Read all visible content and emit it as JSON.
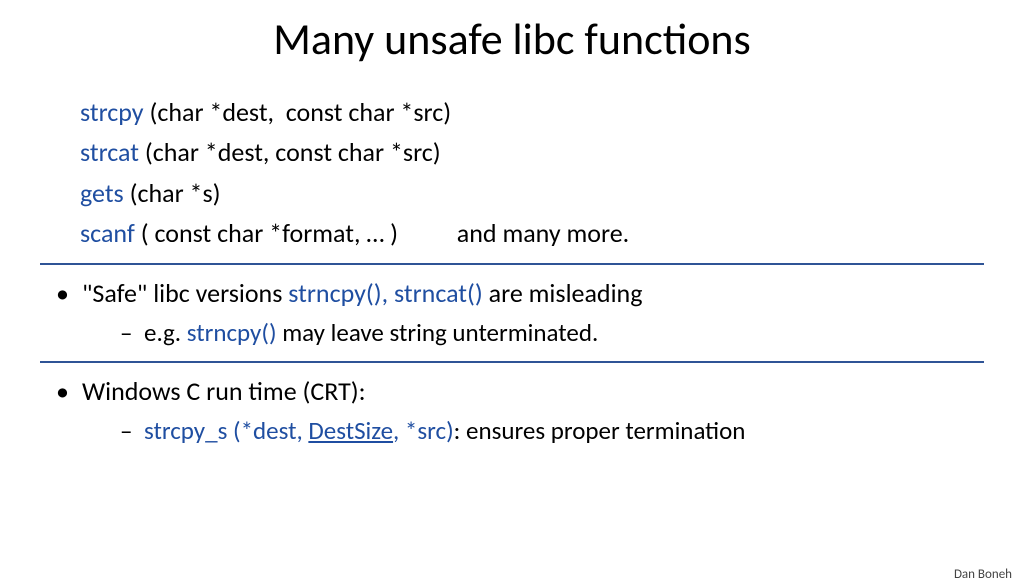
{
  "title": "Many unsafe libc functions",
  "functions": {
    "strcpy": {
      "name": "strcpy",
      "sig": " (char *dest,  const char *src)"
    },
    "strcat": {
      "name": "strcat",
      "sig": " (char *dest, const char *src)"
    },
    "gets": {
      "name": "gets",
      "sig": " (char *s)"
    },
    "scanf": {
      "name": "scanf",
      "sig": " ( const char *format, … )",
      "trail": "          and many more."
    }
  },
  "safe": {
    "lead": "\"Safe\" libc versions  ",
    "fns": "strncpy(), strncat()",
    "trail": "  are misleading",
    "sub_lead": "e.g.  ",
    "sub_fn": "strncpy()",
    "sub_trail": "   may leave string unterminated."
  },
  "crt": {
    "lead": "Windows C run time  (CRT):",
    "sub_fn1": "strcpy_s (*dest, ",
    "sub_dest": "DestSize",
    "sub_fn2": ", *src)",
    "sub_colon": ":",
    "sub_trail": "   ensures proper termination"
  },
  "author": "Dan Boneh"
}
